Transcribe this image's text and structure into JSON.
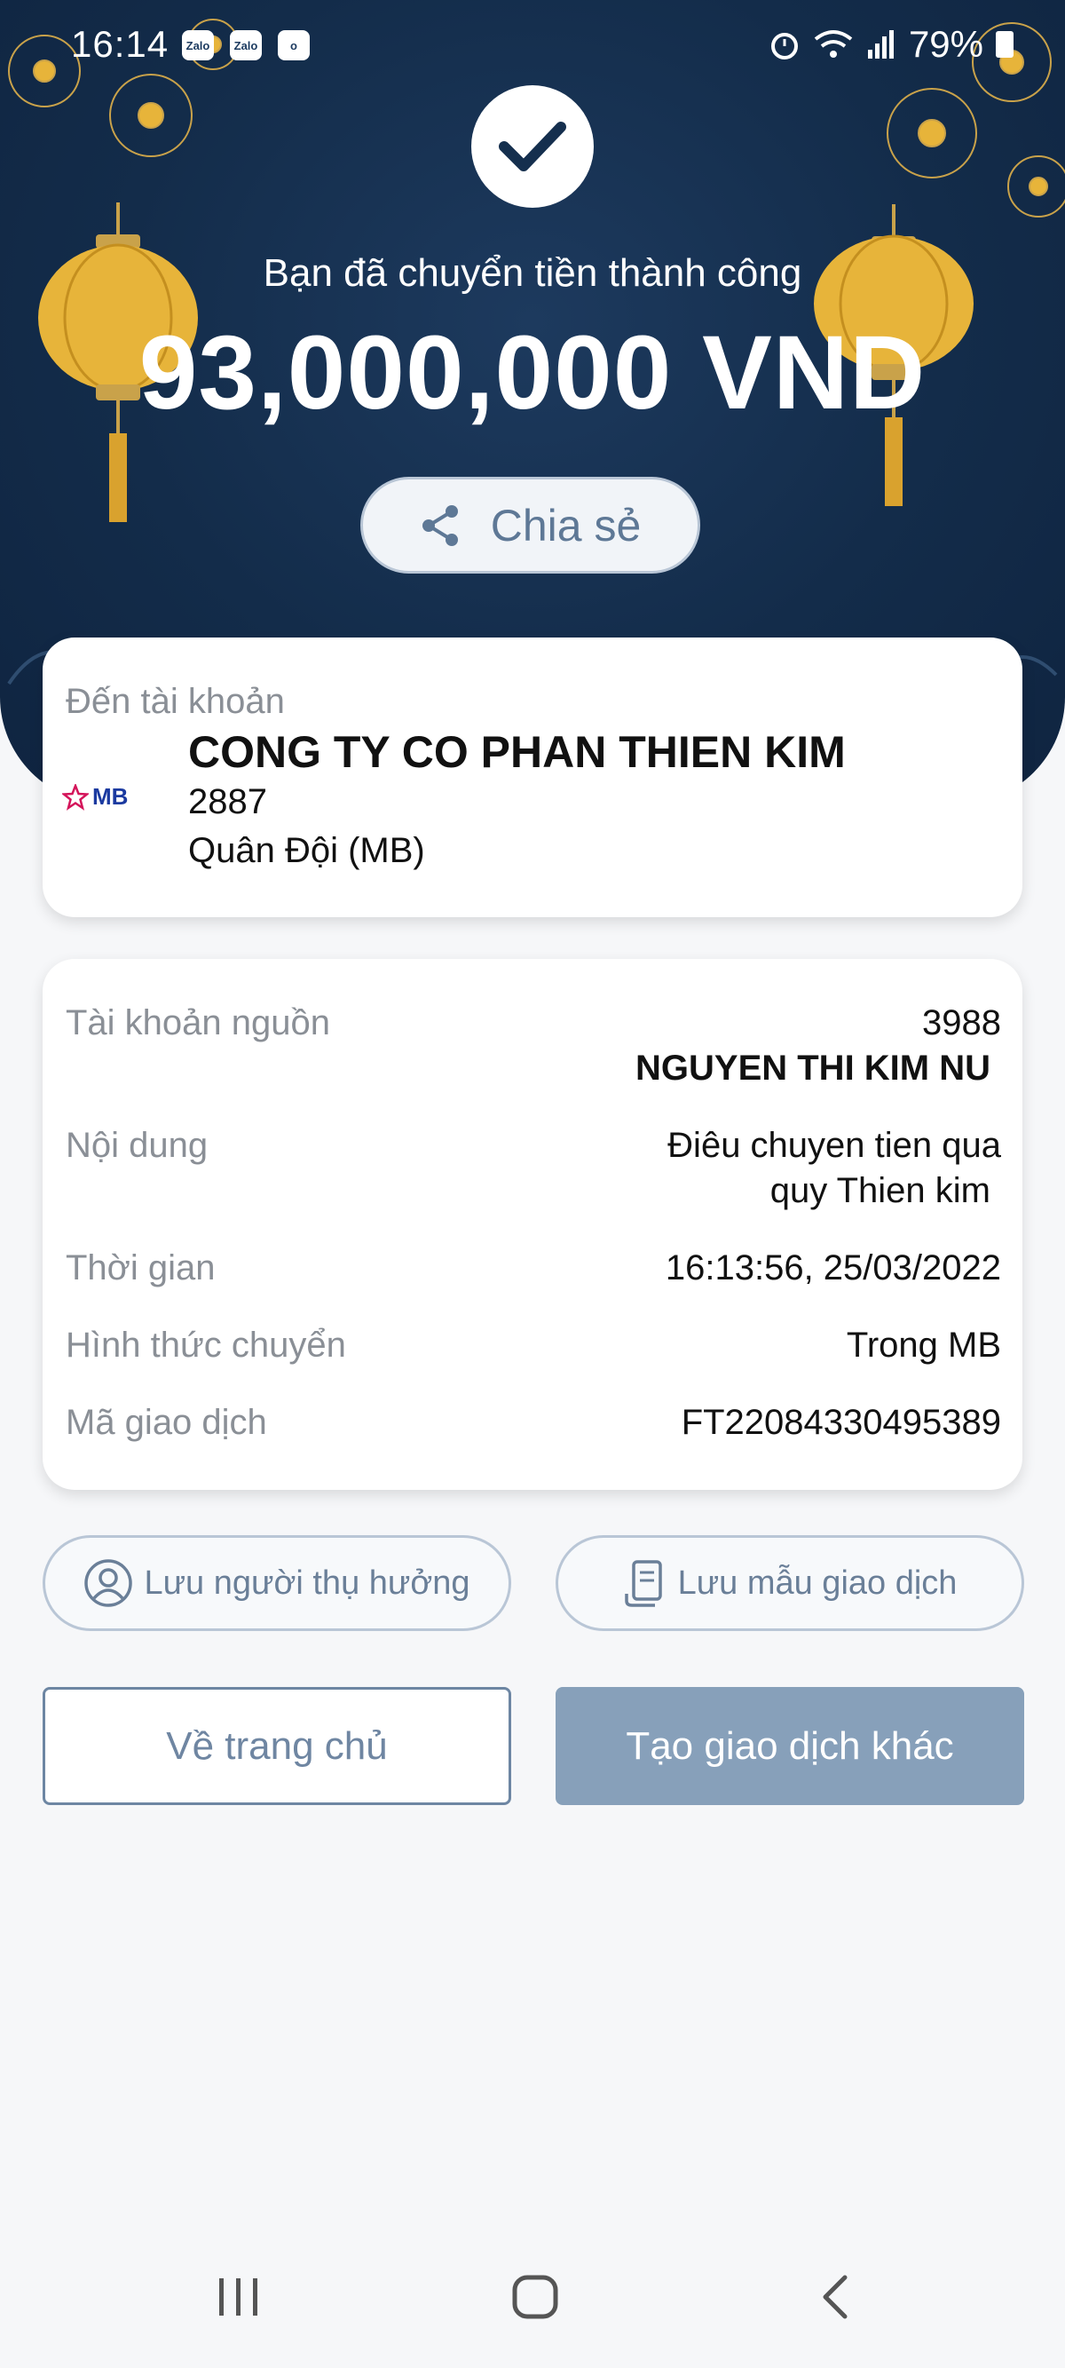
{
  "status_bar": {
    "time": "16:14",
    "app_icons": [
      "Zalo",
      "Zalo",
      "o"
    ],
    "battery": "79%"
  },
  "header": {
    "success_message": "Bạn đã chuyển tiền thành công",
    "amount": "93,000,000 VND",
    "share_label": "Chia sẻ"
  },
  "destination": {
    "label": "Đến tài khoản",
    "bank_logo_text": "MB",
    "account_name": "CONG TY CO PHAN THIEN KIM",
    "account_number": "2887",
    "bank_name": "Quân Đội (MB)"
  },
  "details": {
    "source_label": "Tài khoản nguồn",
    "source_account": "3988",
    "source_name": "NGUYEN THI KIM NU",
    "content_label": "Nội dung",
    "content_line1": "Điêu chuyen tien qua",
    "content_line2": "quy Thien kim",
    "time_label": "Thời gian",
    "time_value": "16:13:56, 25/03/2022",
    "method_label": "Hình thức chuyển",
    "method_value": "Trong MB",
    "txn_label": "Mã giao dịch",
    "txn_value": "FT22084330495389"
  },
  "actions": {
    "save_beneficiary": "Lưu người thụ hưởng",
    "save_template": "Lưu mẫu giao dịch",
    "home": "Về trang chủ",
    "new_transaction": "Tạo giao dịch khác"
  },
  "colors": {
    "header_bg": "#132c4a",
    "primary_button": "#87a0ba",
    "outline": "#b9c6d6",
    "lantern": "#e7b43a"
  },
  "icons": {
    "check": "check-icon",
    "share": "share-icon",
    "user": "user-circle-icon",
    "template": "receipt-icon"
  }
}
